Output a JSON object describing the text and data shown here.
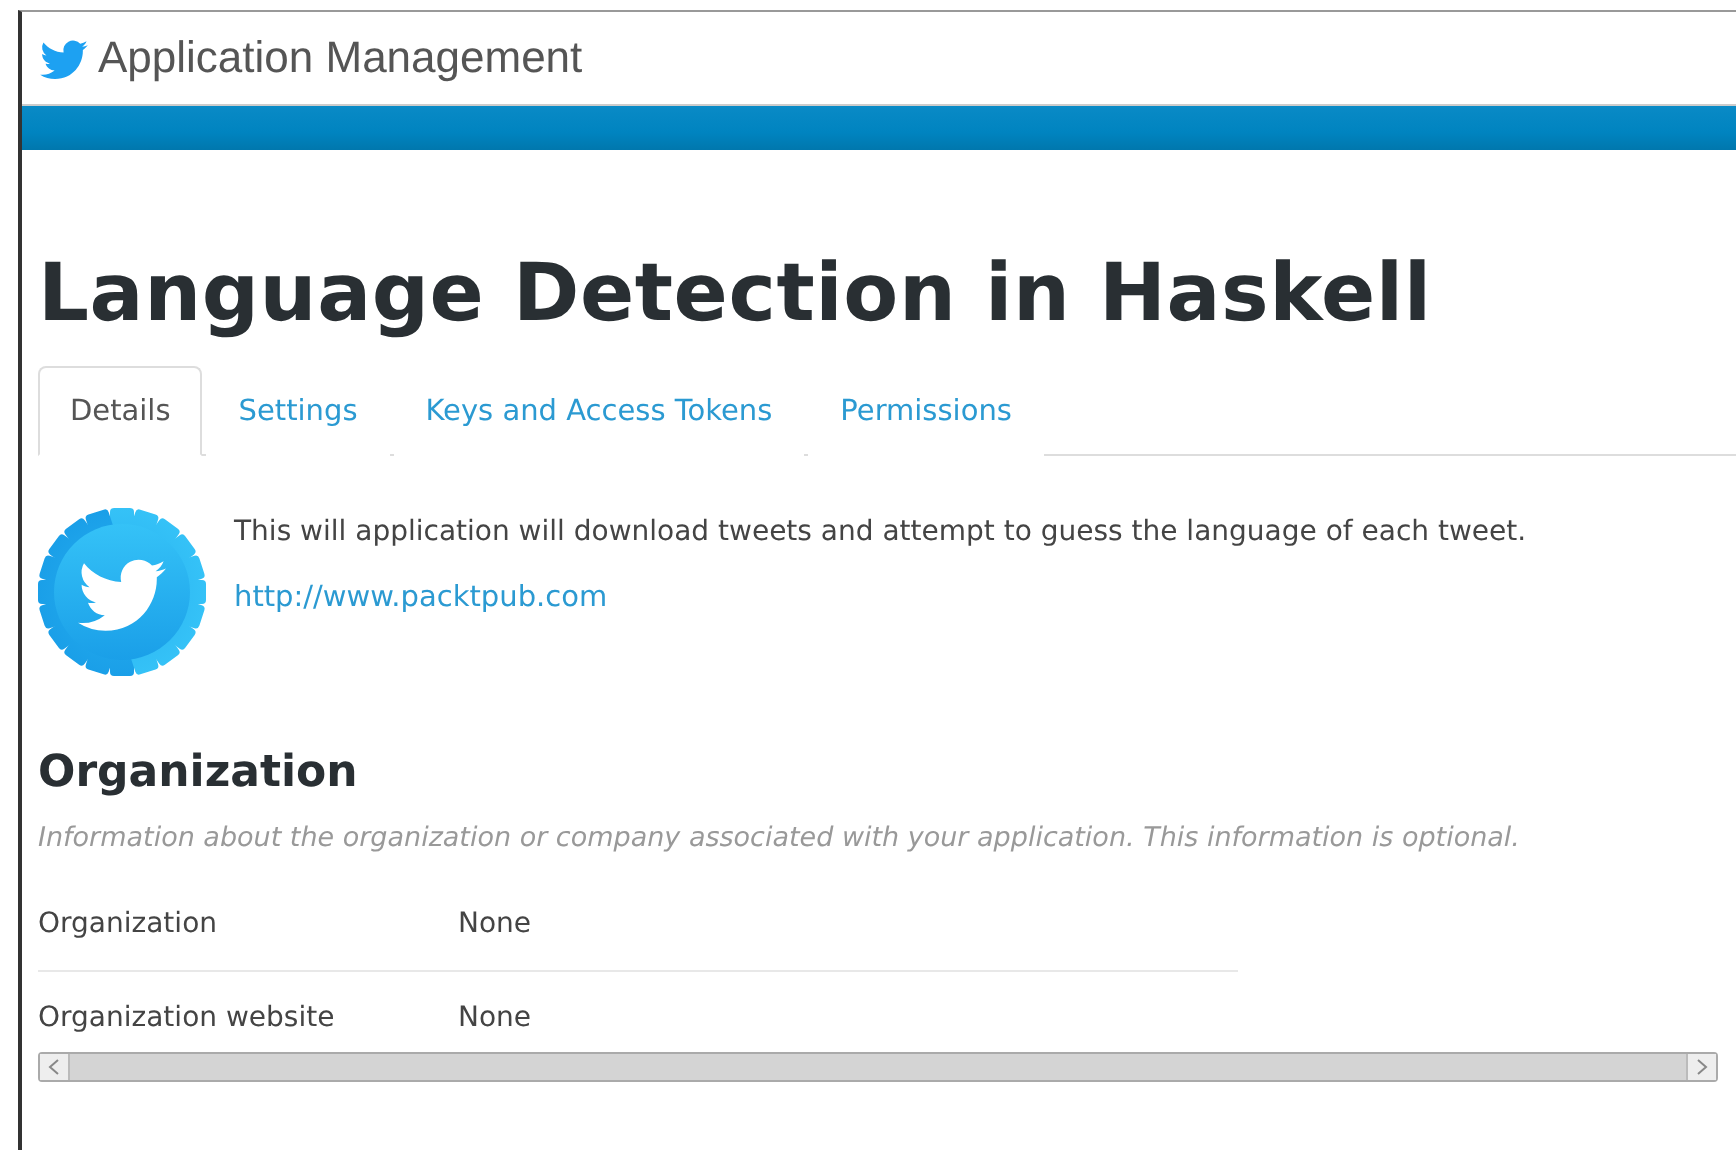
{
  "header": {
    "title": "Application Management"
  },
  "app": {
    "name": "Language Detection in Haskell",
    "description": "This will application will download tweets and attempt to guess the language of each tweet.",
    "website": "http://www.packtpub.com"
  },
  "tabs": [
    {
      "label": "Details",
      "selected": true
    },
    {
      "label": "Settings",
      "selected": false
    },
    {
      "label": "Keys and Access Tokens",
      "selected": false
    },
    {
      "label": "Permissions",
      "selected": false
    }
  ],
  "organization": {
    "heading": "Organization",
    "note": "Information about the organization or company associated with your application. This information is optional.",
    "rows": [
      {
        "label": "Organization",
        "value": "None"
      },
      {
        "label": "Organization website",
        "value": "None"
      }
    ]
  }
}
